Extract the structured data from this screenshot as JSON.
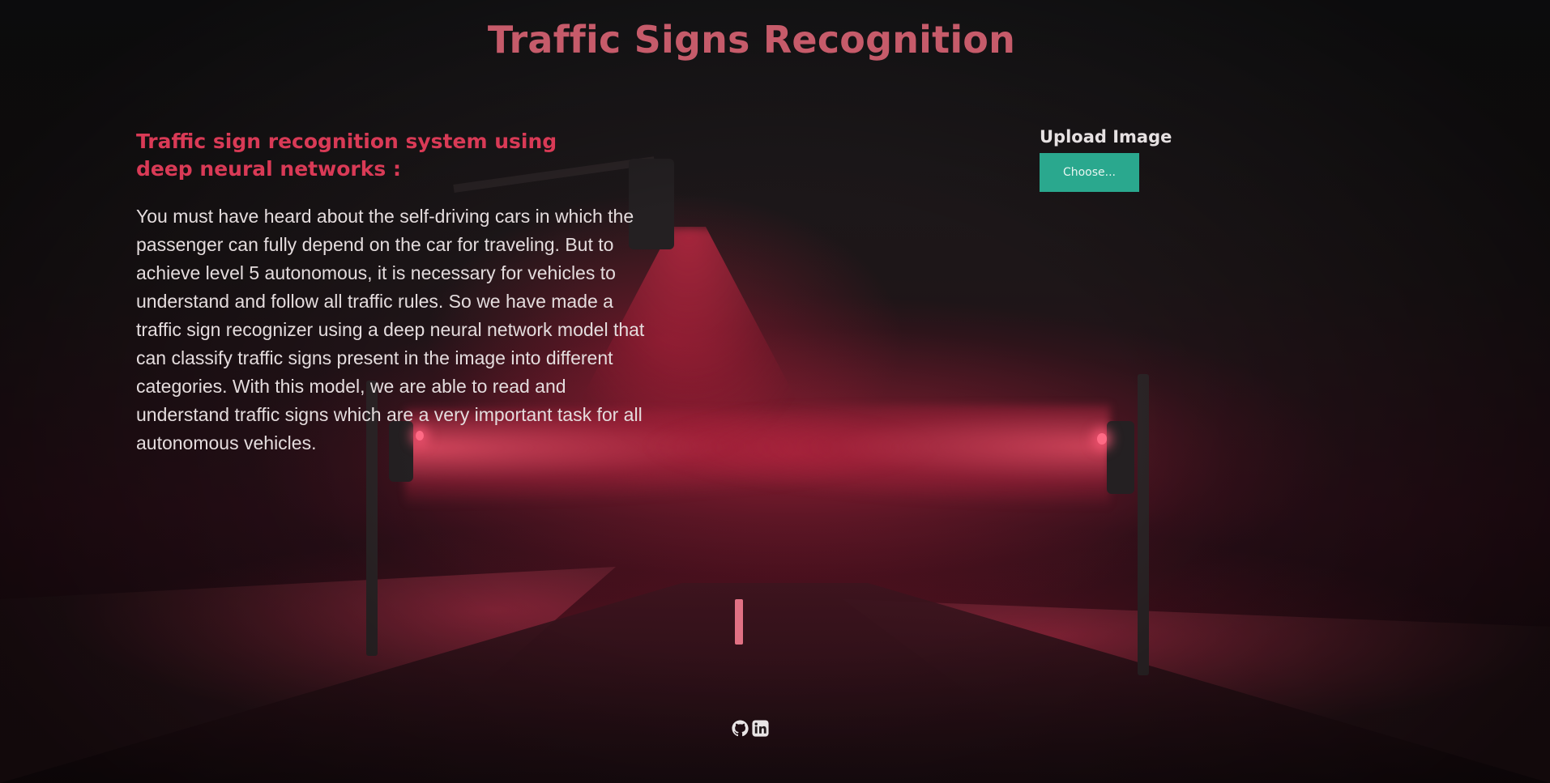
{
  "header": {
    "title": "Traffic Signs Recognition"
  },
  "intro": {
    "heading": "Traffic sign recognition system using deep neural networks :",
    "body": "You must have heard about the self-driving cars in which the passenger can fully depend on the car for traveling. But to achieve level 5 autonomous, it is necessary for vehicles to understand and follow all traffic rules. So we have made a traffic sign recognizer using a deep neural network model that can classify traffic signs present in the image into different categories. With this model, we are able to read and understand traffic signs which are a very important task for all autonomous vehicles."
  },
  "upload": {
    "label": "Upload Image",
    "button_label": "Choose..."
  },
  "footer": {
    "icons": [
      "github-icon",
      "linkedin-icon"
    ]
  },
  "colors": {
    "title": "#c65b6a",
    "heading": "#d93a56",
    "body_text": "#e4dcdd",
    "button_bg": "#2aa88e",
    "button_text": "#e9f6f2",
    "background": "#141012"
  }
}
